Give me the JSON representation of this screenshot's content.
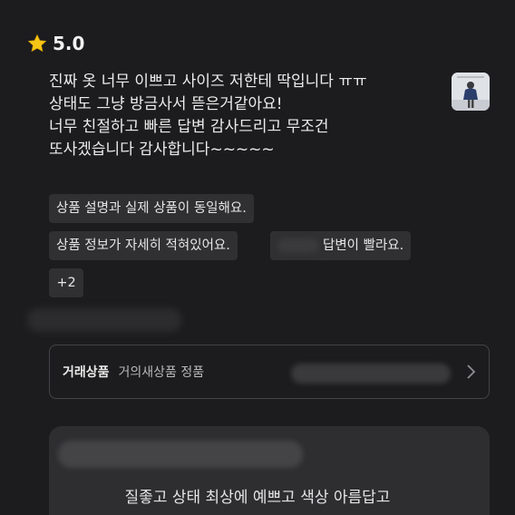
{
  "rating": {
    "value": "5.0",
    "icon": "star-icon",
    "star_color": "#f5c518"
  },
  "review": {
    "lines": [
      "진짜 옷 너무 이쁘고 사이즈 저한테 딱입니다 ㅠㅠ",
      "상태도 그냥 방금사서 뜯은거같아요!",
      "너무 친절하고 빠른 답변 감사드리고 무조건",
      "또사겠습니다 감사합니다~~~~~"
    ]
  },
  "tags": {
    "t1": "상품 설명과 실제 상품이 동일해요.",
    "t2": "상품 정보가 자세히 적혀있어요.",
    "t3": "답변이 빨라요.",
    "more": "+2"
  },
  "product": {
    "label": "거래상품",
    "value": "거의새상품 정품",
    "chevron_icon": "chevron-right-icon"
  },
  "reply": {
    "text": "질좋고 상태 최상에 예쁘고 색상 아름답고"
  }
}
